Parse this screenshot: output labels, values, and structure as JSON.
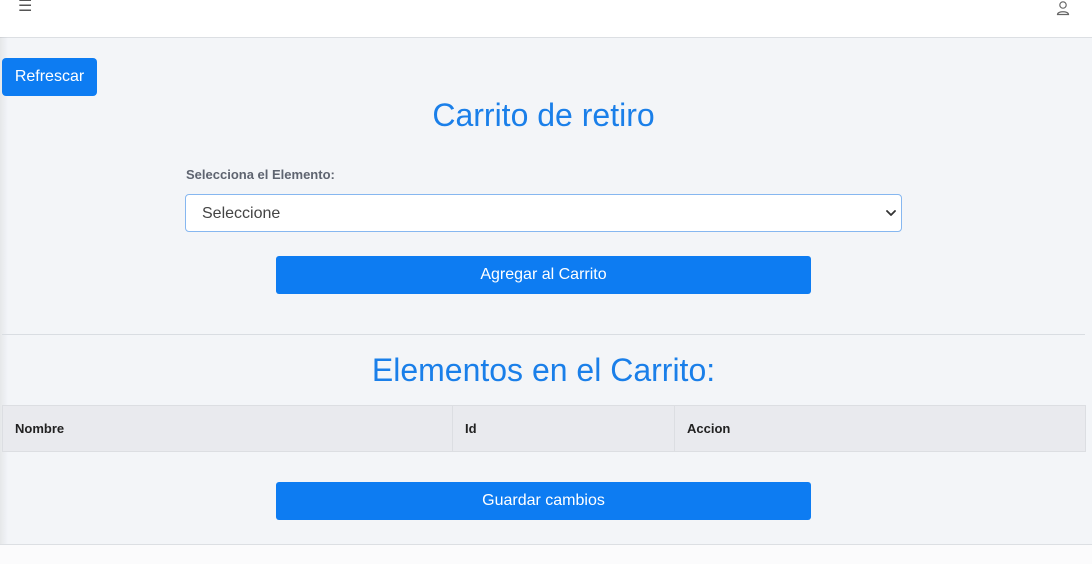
{
  "header": {
    "menu_icon": "hamburger-icon",
    "user_icon": "user-icon"
  },
  "toolbar": {
    "refresh_label": "Refrescar"
  },
  "main": {
    "title": "Carrito de retiro",
    "select_label": "Selecciona el Elemento:",
    "select_value": "Seleccione",
    "add_button_label": "Agregar al Carrito",
    "cart_title": "Elementos en el Carrito:",
    "table_headers": [
      "Nombre",
      "Id",
      "Accion"
    ],
    "save_button_label": "Guardar cambios"
  },
  "colors": {
    "accent": "#0d7cf2",
    "title": "#1a7fe9",
    "background": "#f3f5f8"
  }
}
